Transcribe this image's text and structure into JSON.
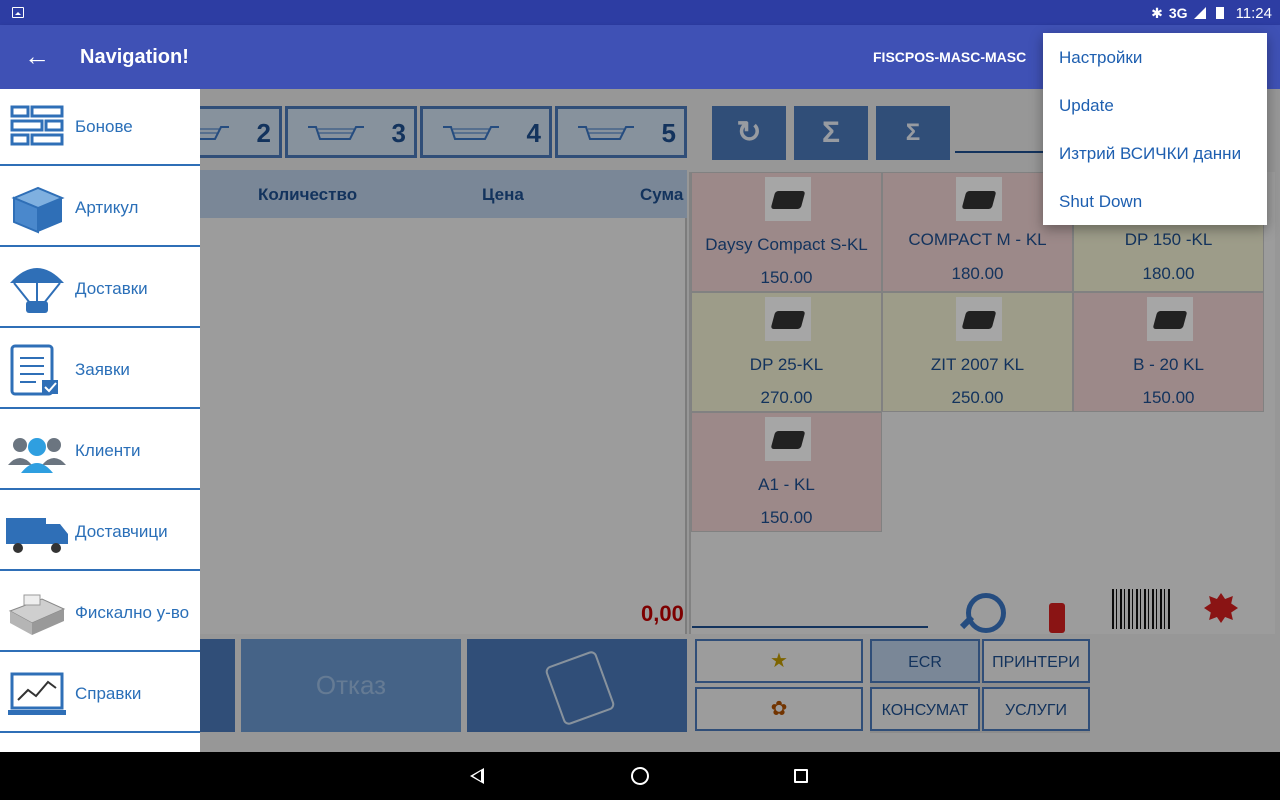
{
  "status_bar": {
    "network": "3G",
    "network_small": "3G",
    "time": "11:24"
  },
  "toolbar": {
    "back_icon": "arrow-back-icon",
    "title": "Navigation!",
    "device_name": "FISCPOS-MASC-MASC"
  },
  "carts": [
    {
      "number": "2"
    },
    {
      "number": "3"
    },
    {
      "number": "4"
    },
    {
      "number": "5"
    }
  ],
  "tools": [
    {
      "icon": "refresh-icon",
      "glyph": "↻"
    },
    {
      "icon": "sigma-icon",
      "glyph": "Σ"
    },
    {
      "icon": "sigma-sub-icon",
      "glyph": "Σ"
    }
  ],
  "grid": {
    "col_quantity": "Количество",
    "col_price": "Цена",
    "col_sum": "Сума",
    "total": "0,00"
  },
  "products": [
    {
      "name": "Daysy Compact S-KL",
      "price": "150.00",
      "color": "pink"
    },
    {
      "name": "COMPACT M - KL",
      "price": "180.00",
      "color": "pink"
    },
    {
      "name": "DP 150 -KL",
      "price": "180.00",
      "color": "yellow"
    },
    {
      "name": "DP 25-KL",
      "price": "270.00",
      "color": "yellow"
    },
    {
      "name": "ZIT 2007 KL",
      "price": "250.00",
      "color": "yellow"
    },
    {
      "name": "B - 20 KL",
      "price": "150.00",
      "color": "pink"
    },
    {
      "name": "A1 - KL",
      "price": "150.00",
      "color": "pink"
    }
  ],
  "buttons": {
    "cancel": "Отказ",
    "favorite_glyph": "★",
    "award_glyph": "✿"
  },
  "categories": {
    "ecr": "ECR",
    "printers": "ПРИНТЕРИ",
    "consumables": "КОНСУМАТ",
    "services": "УСЛУГИ"
  },
  "drawer": [
    {
      "label": "Бонове",
      "icon": "receipts-icon"
    },
    {
      "label": "Артикул",
      "icon": "box-icon"
    },
    {
      "label": "Доставки",
      "icon": "parachute-icon"
    },
    {
      "label": "Заявки",
      "icon": "clipboard-icon"
    },
    {
      "label": "Клиенти",
      "icon": "clients-icon"
    },
    {
      "label": "Доставчици",
      "icon": "truck-icon"
    },
    {
      "label": "Фискално у-во",
      "icon": "fiscal-printer-icon"
    },
    {
      "label": "Справки",
      "icon": "chart-laptop-icon"
    }
  ],
  "menu": [
    {
      "label": "Настройки"
    },
    {
      "label": "Update"
    },
    {
      "label": "Изтрий ВСИЧКИ данни"
    },
    {
      "label": "Shut Down"
    }
  ]
}
